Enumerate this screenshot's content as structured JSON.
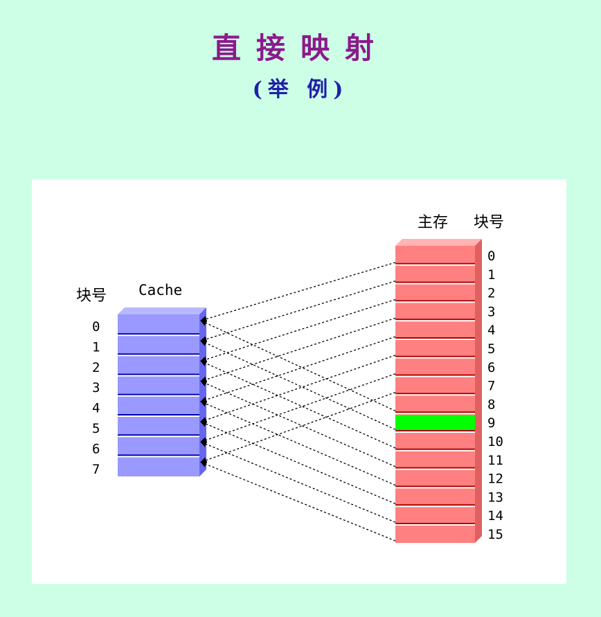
{
  "title": "直接映射",
  "subtitle": "(举 例)",
  "cache": {
    "block_label": "块号",
    "name_label": "Cache",
    "block_numbers": [
      "0",
      "1",
      "2",
      "3",
      "4",
      "5",
      "6",
      "7"
    ]
  },
  "memory": {
    "name_label": "主存",
    "block_label": "块号",
    "block_numbers": [
      "0",
      "1",
      "2",
      "3",
      "4",
      "5",
      "6",
      "7",
      "8",
      "9",
      "10",
      "11",
      "12",
      "13",
      "14",
      "15"
    ],
    "highlighted_block": 9
  },
  "colors": {
    "background": "#ccffe6",
    "title": "#8b1a8b",
    "subtitle": "#1f1fa8",
    "cache_fill": "#9999ff",
    "memory_fill": "#ff8080",
    "highlight": "#00ff00"
  }
}
